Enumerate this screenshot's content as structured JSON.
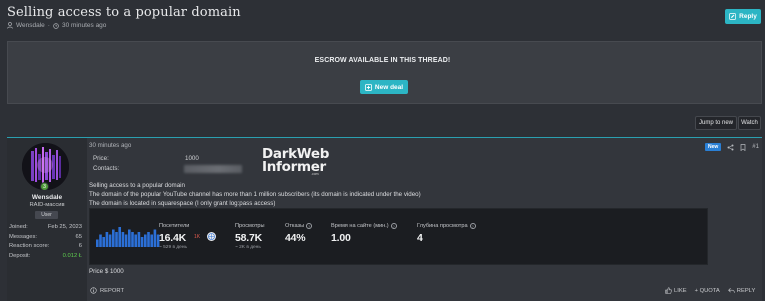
{
  "thread": {
    "title": "Selling access to a popular domain",
    "author": "Wensdale",
    "separator": "·",
    "time": "30 minutes ago",
    "reply_label": "Reply"
  },
  "escrow": {
    "text": "ESCROW AVAILABLE IN THIS THREAD!",
    "new_deal_label": "New deal"
  },
  "toolbar": {
    "jump_label": "Jump to new",
    "watch_label": "Watch"
  },
  "user": {
    "name": "Wensdale",
    "title": "RAID-массив",
    "role": "User",
    "level": "3",
    "stats": [
      {
        "label": "Joined:",
        "value": "Feb 25, 2023"
      },
      {
        "label": "Messages:",
        "value": "65"
      },
      {
        "label": "Reaction score:",
        "value": "6"
      },
      {
        "label": "Deposit:",
        "value": "0.012 Ł"
      }
    ]
  },
  "post": {
    "time": "30 minutes ago",
    "badge": "New",
    "number": "#1",
    "price_label": "Price:",
    "price_value": "1000",
    "contacts_label": "Contacts:",
    "watermark_line1": "DarkWeb",
    "watermark_line2": "Informer",
    "watermark_sub": ".com",
    "lines": [
      "Selling access to a popular domain",
      "The domain of the popular YouTube channel has more than 1 million subscribers (its domain is indicated under the video)",
      "The domain is located in squarespace (I only grant log:pass access)"
    ],
    "price_line": "Price $ 1000",
    "report_label": "REPORT",
    "like_label": "LIKE",
    "quote_label": "+ QUOTA",
    "reply_label": "REPLY"
  },
  "stats_panel": {
    "visitors": {
      "label": "Посетители",
      "value": "16.4K",
      "change": "1K",
      "sub": "~ 529 в день"
    },
    "views": {
      "label": "Просмотры",
      "value": "58.7K",
      "sub": "~ 2K в день"
    },
    "bounce": {
      "label": "Отказы",
      "value": "44%"
    },
    "time_on_site": {
      "label": "Время на сайте (мин.)",
      "value": "1.00"
    },
    "depth": {
      "label": "Глубина просмотра",
      "value": "4"
    },
    "sparkline": [
      3,
      5,
      4,
      6,
      5,
      7,
      6,
      8,
      6,
      5,
      7,
      6,
      5,
      6,
      4,
      5,
      6,
      5,
      7,
      5
    ]
  },
  "colors": {
    "accent": "#2cb5c4",
    "background": "#2d3036",
    "new_badge": "#2a7fd4",
    "deposit": "#5fcf4f",
    "sparkline": "#2b6fd6"
  },
  "icons": {
    "reply": "pencil-icon",
    "new_deal": "plus-box-icon",
    "user": "user-icon",
    "clock": "clock-icon",
    "share": "share-icon",
    "bookmark": "bookmark-icon",
    "like": "thumbs-up-icon",
    "report": "info-circle-icon"
  }
}
